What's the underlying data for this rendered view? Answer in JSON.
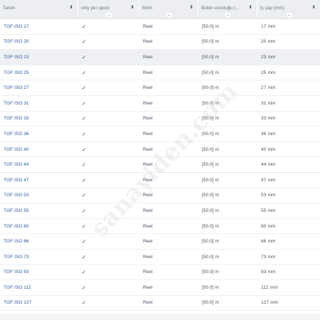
{
  "table": {
    "headers": [
      {
        "label": "Tanım"
      },
      {
        "label": "only per spool"
      },
      {
        "label": "Birim"
      },
      {
        "label": "Bobin uzunluğu (..."
      },
      {
        "label": "İç çap (mm)"
      }
    ],
    "rows": [
      {
        "code": "TGF ISO 17",
        "check": "✓",
        "unit": "Reel",
        "length": "[50.0]  m",
        "diameter": "17  mm"
      },
      {
        "code": "TGF ISO 20",
        "check": "✓",
        "unit": "Reel",
        "length": "[50.0]  m",
        "diameter": "20  mm"
      },
      {
        "code": "TGF ISO 23",
        "check": "✓",
        "unit": "Reel",
        "length": "[50.0]  m",
        "diameter": "23  mm"
      },
      {
        "code": "TGF ISO 25",
        "check": "✓",
        "unit": "Reel",
        "length": "[50.0]  m",
        "diameter": "25  mm"
      },
      {
        "code": "TGF ISO 27",
        "check": "✓",
        "unit": "Reel",
        "length": "[50.0]  m",
        "diameter": "27  mm"
      },
      {
        "code": "TGF ISO 31",
        "check": "✓",
        "unit": "Reel",
        "length": "[50.0]  m",
        "diameter": "31  mm"
      },
      {
        "code": "TGF ISO 33",
        "check": "✓",
        "unit": "Reel",
        "length": "[50.0]  m",
        "diameter": "33  mm"
      },
      {
        "code": "TGF ISO 36",
        "check": "✓",
        "unit": "Reel",
        "length": "[50.0]  m",
        "diameter": "36  mm"
      },
      {
        "code": "TGF ISO 40",
        "check": "✓",
        "unit": "Reel",
        "length": "[50.0]  m",
        "diameter": "40  mm"
      },
      {
        "code": "TGF ISO 44",
        "check": "✓",
        "unit": "Reel",
        "length": "[50.0]  m",
        "diameter": "44  mm"
      },
      {
        "code": "TGF ISO 47",
        "check": "✓",
        "unit": "Reel",
        "length": "[50.0]  m",
        "diameter": "47  mm"
      },
      {
        "code": "TGF ISO 53",
        "check": "✓",
        "unit": "Reel",
        "length": "[50.0]  m",
        "diameter": "53  mm"
      },
      {
        "code": "TGF ISO 55",
        "check": "✓",
        "unit": "Reel",
        "length": "[50.0]  m",
        "diameter": "55  mm"
      },
      {
        "code": "TGF ISO 60",
        "check": "✓",
        "unit": "Reel",
        "length": "[50.0]  m",
        "diameter": "60  mm"
      },
      {
        "code": "TGF ISO 66",
        "check": "✓",
        "unit": "Reel",
        "length": "[50.0]  m",
        "diameter": "66  mm"
      },
      {
        "code": "TGF ISO 73",
        "check": "✓",
        "unit": "Reel",
        "length": "[50.0]  m",
        "diameter": "73  mm"
      },
      {
        "code": "TGF ISO 93",
        "check": "✓",
        "unit": "Reel",
        "length": "[50.0]  m",
        "diameter": "93  mm"
      },
      {
        "code": "TGF ISO 112",
        "check": "✓",
        "unit": "Reel",
        "length": "[50.0]  m",
        "diameter": "112  mm"
      },
      {
        "code": "TGF ISO 127",
        "check": "✓",
        "unit": "Reel",
        "length": "[50.0]  m",
        "diameter": "127  mm"
      }
    ]
  },
  "watermark": "sanayiden.com",
  "colors": {
    "header_bg": "#eceef2",
    "link": "#2b5d9c",
    "highlight_row": "#eef0f4",
    "text": "#4b5563"
  },
  "icons": {
    "sort": "sort-arrows-icon",
    "dropdown": "chevron-down-icon",
    "check": "checkmark-icon"
  }
}
